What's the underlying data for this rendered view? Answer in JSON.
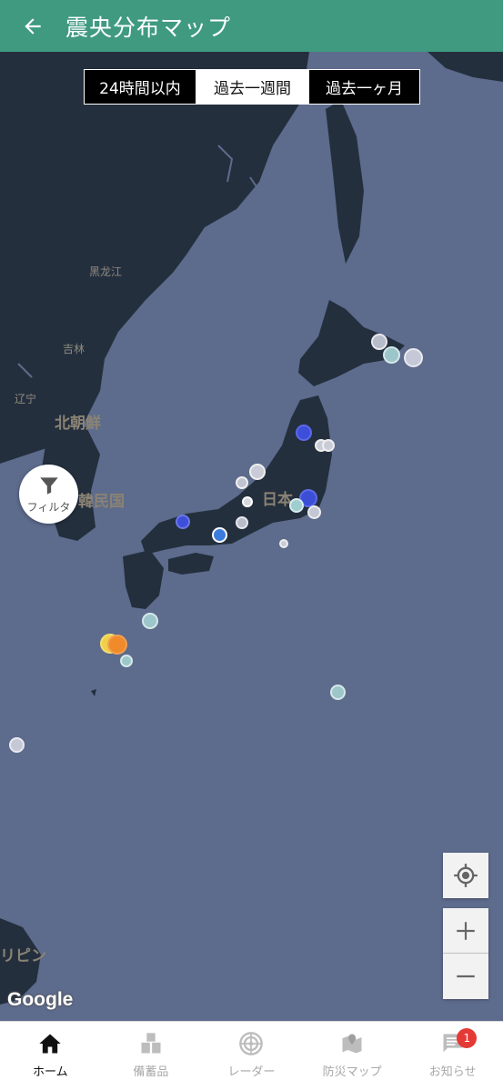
{
  "header": {
    "title": "震央分布マップ",
    "back_icon": "arrow-left-icon"
  },
  "range_tabs": [
    {
      "label": "24時間以内",
      "selected": false
    },
    {
      "label": "過去一週間",
      "selected": true
    },
    {
      "label": "過去一ヶ月",
      "selected": false
    }
  ],
  "map": {
    "labels": {
      "heilongjiang": "黑龙江",
      "jilin": "吉林",
      "liaoning": "辽宁",
      "north_korea": "北朝鮮",
      "south_korea": "韓民国",
      "japan": "日本",
      "philippines": "リピン"
    },
    "attribution": "Google"
  },
  "filter": {
    "label": "フィルタ",
    "icon": "funnel-icon"
  },
  "map_controls": {
    "locate_icon": "crosshair-icon",
    "zoom_in": "+",
    "zoom_out": "−"
  },
  "bottom_nav": [
    {
      "label": "ホーム",
      "icon": "home-icon",
      "active": true
    },
    {
      "label": "備蓄品",
      "icon": "boxes-icon",
      "active": false
    },
    {
      "label": "レーダー",
      "icon": "radar-icon",
      "active": false
    },
    {
      "label": "防災マップ",
      "icon": "map-pin-icon",
      "active": false
    },
    {
      "label": "お知らせ",
      "icon": "chat-icon",
      "active": false,
      "badge": "1"
    }
  ],
  "colors": {
    "header": "#3f9a80",
    "land": "#242f3e",
    "sea": "#5d6b8c",
    "badge": "#e53935"
  }
}
